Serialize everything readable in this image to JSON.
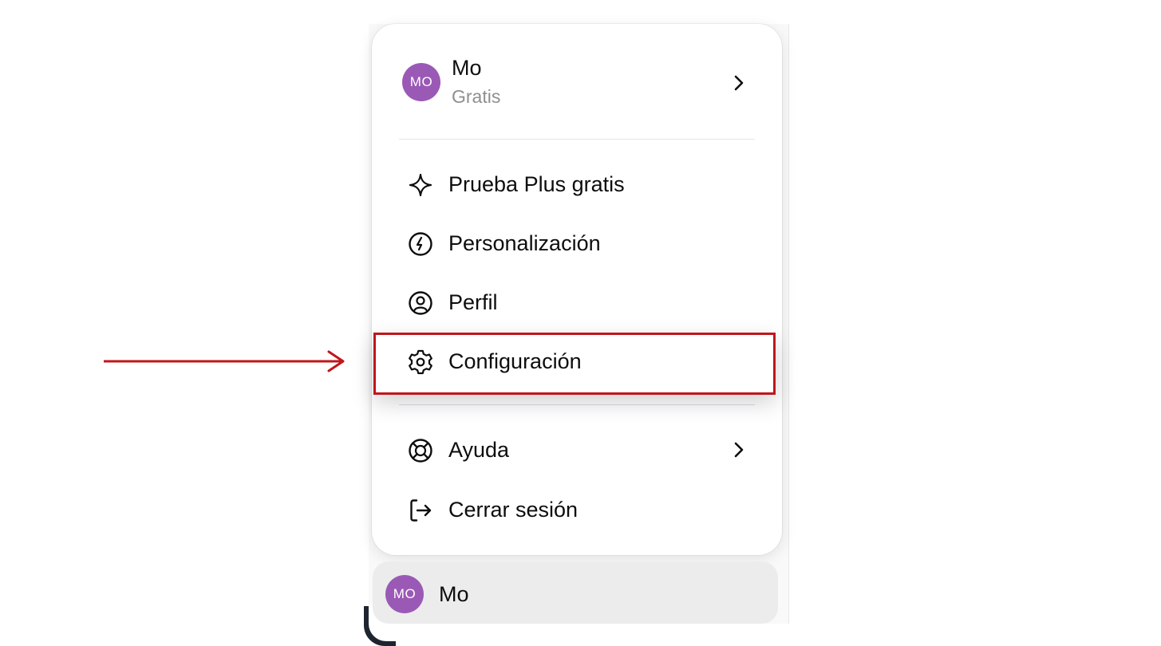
{
  "account": {
    "initials": "MO",
    "name": "Mo",
    "plan": "Gratis",
    "avatar_color": "#9b59b6"
  },
  "menu": {
    "items": [
      {
        "label": "Prueba Plus gratis",
        "icon": "sparkle-icon"
      },
      {
        "label": "Personalización",
        "icon": "personalization-icon"
      },
      {
        "label": "Perfil",
        "icon": "profile-icon"
      },
      {
        "label": "Configuración",
        "icon": "gear-icon"
      },
      {
        "label": "Ayuda",
        "icon": "lifebuoy-icon"
      },
      {
        "label": "Cerrar sesión",
        "icon": "logout-icon"
      }
    ]
  },
  "bottom_user": {
    "initials": "MO",
    "name": "Mo"
  },
  "annotation": {
    "highlight_color": "#c0161b"
  }
}
